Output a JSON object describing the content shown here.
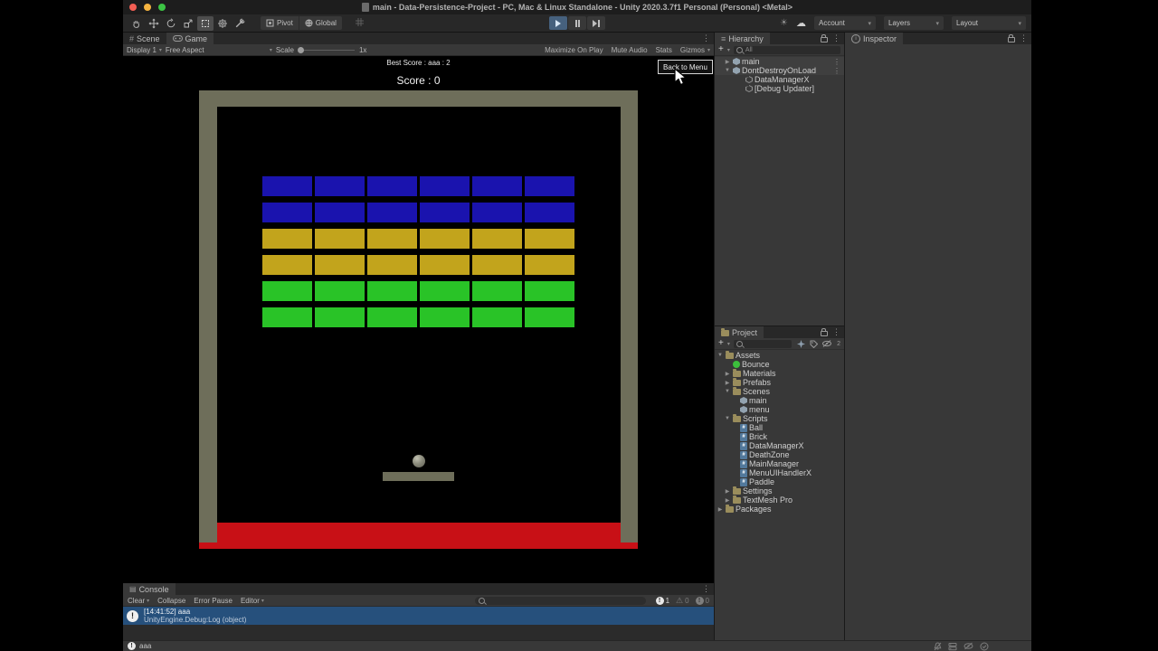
{
  "window": {
    "title": "main - Data-Persistence-Project - PC, Mac & Linux Standalone - Unity 2020.3.7f1 Personal (Personal) <Metal>"
  },
  "toolbar": {
    "pivot": "Pivot",
    "global": "Global",
    "account": "Account",
    "layers": "Layers",
    "layout": "Layout"
  },
  "icons": {
    "caret": "▾",
    "kebab": "⋮",
    "hamburger": "≡",
    "console_tab": "▤",
    "scene_grid": "#",
    "cloud": "☁",
    "activity": "☀",
    "plus": "+",
    "warning": "⚠",
    "exclaim": "!",
    "info_i": "i",
    "arrow_open": "▼",
    "arrow_closed": "▶",
    "script_glyph": "#"
  },
  "game_view": {
    "tabs": [
      {
        "label": "Scene"
      },
      {
        "label": "Game"
      }
    ],
    "controls": {
      "display": "Display 1",
      "aspect": "Free Aspect",
      "scale_label": "Scale",
      "scale_value": "1x",
      "maximize": "Maximize On Play",
      "mute": "Mute Audio",
      "stats": "Stats",
      "gizmos": "Gizmos"
    },
    "hud": {
      "best_score": "Best Score : aaa : 2",
      "score": "Score : 0",
      "back_button": "Back to Menu"
    },
    "colors": {
      "frame": "#6e6e5a",
      "death_zone": "#c81016",
      "ball": "#8b8b7c",
      "selection_blue": "#26507c"
    },
    "bricks": {
      "columns": 6,
      "row_colors": [
        "blue",
        "blue",
        "yellow",
        "yellow",
        "green",
        "green"
      ],
      "palette": {
        "blue": "#1a13ae",
        "yellow": "#c2a41c",
        "green": "#29c327"
      }
    }
  },
  "hierarchy": {
    "title": "Hierarchy",
    "search_placeholder": "All",
    "items": [
      {
        "label": "main",
        "icon": "scene",
        "depth": 0,
        "arrow": "closed",
        "scene_row": true,
        "menu": true
      },
      {
        "label": "DontDestroyOnLoad",
        "icon": "scene",
        "depth": 0,
        "arrow": "open",
        "scene_row": true,
        "menu": true
      },
      {
        "label": "DataManagerX",
        "icon": "gameobject",
        "depth": 1,
        "arrow": "none"
      },
      {
        "label": "[Debug Updater]",
        "icon": "gameobject",
        "depth": 1,
        "arrow": "none"
      }
    ]
  },
  "inspector": {
    "title": "Inspector"
  },
  "project": {
    "title": "Project",
    "hidden_count": "2",
    "items": [
      {
        "label": "Assets",
        "icon": "folder-open",
        "depth": 0,
        "arrow": "open"
      },
      {
        "label": "Bounce",
        "icon": "physics-material",
        "depth": 1,
        "arrow": "none"
      },
      {
        "label": "Materials",
        "icon": "folder",
        "depth": 1,
        "arrow": "closed"
      },
      {
        "label": "Prefabs",
        "icon": "folder",
        "depth": 1,
        "arrow": "closed"
      },
      {
        "label": "Scenes",
        "icon": "folder-open",
        "depth": 1,
        "arrow": "open"
      },
      {
        "label": "main",
        "icon": "scene",
        "depth": 2,
        "arrow": "none"
      },
      {
        "label": "menu",
        "icon": "scene",
        "depth": 2,
        "arrow": "none"
      },
      {
        "label": "Scripts",
        "icon": "folder-open",
        "depth": 1,
        "arrow": "open"
      },
      {
        "label": "Ball",
        "icon": "script",
        "depth": 2,
        "arrow": "none"
      },
      {
        "label": "Brick",
        "icon": "script",
        "depth": 2,
        "arrow": "none"
      },
      {
        "label": "DataManagerX",
        "icon": "script",
        "depth": 2,
        "arrow": "none"
      },
      {
        "label": "DeathZone",
        "icon": "script",
        "depth": 2,
        "arrow": "none"
      },
      {
        "label": "MainManager",
        "icon": "script",
        "depth": 2,
        "arrow": "none"
      },
      {
        "label": "MenuUIHandlerX",
        "icon": "script",
        "depth": 2,
        "arrow": "none"
      },
      {
        "label": "Paddle",
        "icon": "script",
        "depth": 2,
        "arrow": "none"
      },
      {
        "label": "Settings",
        "icon": "folder",
        "depth": 1,
        "arrow": "closed"
      },
      {
        "label": "TextMesh Pro",
        "icon": "folder",
        "depth": 1,
        "arrow": "closed"
      },
      {
        "label": "Packages",
        "icon": "folder",
        "depth": 0,
        "arrow": "closed"
      }
    ]
  },
  "console": {
    "title": "Console",
    "buttons": {
      "clear": "Clear",
      "collapse": "Collapse",
      "error_pause": "Error Pause",
      "editor": "Editor"
    },
    "counts": {
      "info": "1",
      "warnings": "0",
      "errors": "0"
    },
    "log": {
      "line1": "[14:41:52] aaa",
      "line2": "UnityEngine.Debug:Log (object)"
    }
  },
  "status_bar": {
    "message": "aaa"
  }
}
